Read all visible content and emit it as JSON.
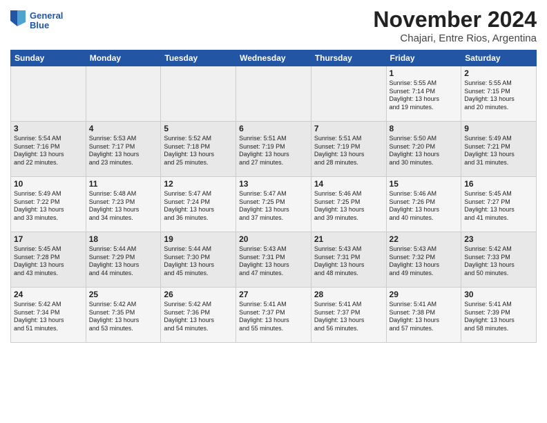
{
  "logo": {
    "line1": "General",
    "line2": "Blue"
  },
  "title": "November 2024",
  "location": "Chajari, Entre Rios, Argentina",
  "headers": [
    "Sunday",
    "Monday",
    "Tuesday",
    "Wednesday",
    "Thursday",
    "Friday",
    "Saturday"
  ],
  "weeks": [
    [
      {
        "day": "",
        "info": ""
      },
      {
        "day": "",
        "info": ""
      },
      {
        "day": "",
        "info": ""
      },
      {
        "day": "",
        "info": ""
      },
      {
        "day": "",
        "info": ""
      },
      {
        "day": "1",
        "info": "Sunrise: 5:55 AM\nSunset: 7:14 PM\nDaylight: 13 hours\nand 19 minutes."
      },
      {
        "day": "2",
        "info": "Sunrise: 5:55 AM\nSunset: 7:15 PM\nDaylight: 13 hours\nand 20 minutes."
      }
    ],
    [
      {
        "day": "3",
        "info": "Sunrise: 5:54 AM\nSunset: 7:16 PM\nDaylight: 13 hours\nand 22 minutes."
      },
      {
        "day": "4",
        "info": "Sunrise: 5:53 AM\nSunset: 7:17 PM\nDaylight: 13 hours\nand 23 minutes."
      },
      {
        "day": "5",
        "info": "Sunrise: 5:52 AM\nSunset: 7:18 PM\nDaylight: 13 hours\nand 25 minutes."
      },
      {
        "day": "6",
        "info": "Sunrise: 5:51 AM\nSunset: 7:19 PM\nDaylight: 13 hours\nand 27 minutes."
      },
      {
        "day": "7",
        "info": "Sunrise: 5:51 AM\nSunset: 7:19 PM\nDaylight: 13 hours\nand 28 minutes."
      },
      {
        "day": "8",
        "info": "Sunrise: 5:50 AM\nSunset: 7:20 PM\nDaylight: 13 hours\nand 30 minutes."
      },
      {
        "day": "9",
        "info": "Sunrise: 5:49 AM\nSunset: 7:21 PM\nDaylight: 13 hours\nand 31 minutes."
      }
    ],
    [
      {
        "day": "10",
        "info": "Sunrise: 5:49 AM\nSunset: 7:22 PM\nDaylight: 13 hours\nand 33 minutes."
      },
      {
        "day": "11",
        "info": "Sunrise: 5:48 AM\nSunset: 7:23 PM\nDaylight: 13 hours\nand 34 minutes."
      },
      {
        "day": "12",
        "info": "Sunrise: 5:47 AM\nSunset: 7:24 PM\nDaylight: 13 hours\nand 36 minutes."
      },
      {
        "day": "13",
        "info": "Sunrise: 5:47 AM\nSunset: 7:25 PM\nDaylight: 13 hours\nand 37 minutes."
      },
      {
        "day": "14",
        "info": "Sunrise: 5:46 AM\nSunset: 7:25 PM\nDaylight: 13 hours\nand 39 minutes."
      },
      {
        "day": "15",
        "info": "Sunrise: 5:46 AM\nSunset: 7:26 PM\nDaylight: 13 hours\nand 40 minutes."
      },
      {
        "day": "16",
        "info": "Sunrise: 5:45 AM\nSunset: 7:27 PM\nDaylight: 13 hours\nand 41 minutes."
      }
    ],
    [
      {
        "day": "17",
        "info": "Sunrise: 5:45 AM\nSunset: 7:28 PM\nDaylight: 13 hours\nand 43 minutes."
      },
      {
        "day": "18",
        "info": "Sunrise: 5:44 AM\nSunset: 7:29 PM\nDaylight: 13 hours\nand 44 minutes."
      },
      {
        "day": "19",
        "info": "Sunrise: 5:44 AM\nSunset: 7:30 PM\nDaylight: 13 hours\nand 45 minutes."
      },
      {
        "day": "20",
        "info": "Sunrise: 5:43 AM\nSunset: 7:31 PM\nDaylight: 13 hours\nand 47 minutes."
      },
      {
        "day": "21",
        "info": "Sunrise: 5:43 AM\nSunset: 7:31 PM\nDaylight: 13 hours\nand 48 minutes."
      },
      {
        "day": "22",
        "info": "Sunrise: 5:43 AM\nSunset: 7:32 PM\nDaylight: 13 hours\nand 49 minutes."
      },
      {
        "day": "23",
        "info": "Sunrise: 5:42 AM\nSunset: 7:33 PM\nDaylight: 13 hours\nand 50 minutes."
      }
    ],
    [
      {
        "day": "24",
        "info": "Sunrise: 5:42 AM\nSunset: 7:34 PM\nDaylight: 13 hours\nand 51 minutes."
      },
      {
        "day": "25",
        "info": "Sunrise: 5:42 AM\nSunset: 7:35 PM\nDaylight: 13 hours\nand 53 minutes."
      },
      {
        "day": "26",
        "info": "Sunrise: 5:42 AM\nSunset: 7:36 PM\nDaylight: 13 hours\nand 54 minutes."
      },
      {
        "day": "27",
        "info": "Sunrise: 5:41 AM\nSunset: 7:37 PM\nDaylight: 13 hours\nand 55 minutes."
      },
      {
        "day": "28",
        "info": "Sunrise: 5:41 AM\nSunset: 7:37 PM\nDaylight: 13 hours\nand 56 minutes."
      },
      {
        "day": "29",
        "info": "Sunrise: 5:41 AM\nSunset: 7:38 PM\nDaylight: 13 hours\nand 57 minutes."
      },
      {
        "day": "30",
        "info": "Sunrise: 5:41 AM\nSunset: 7:39 PM\nDaylight: 13 hours\nand 58 minutes."
      }
    ]
  ]
}
